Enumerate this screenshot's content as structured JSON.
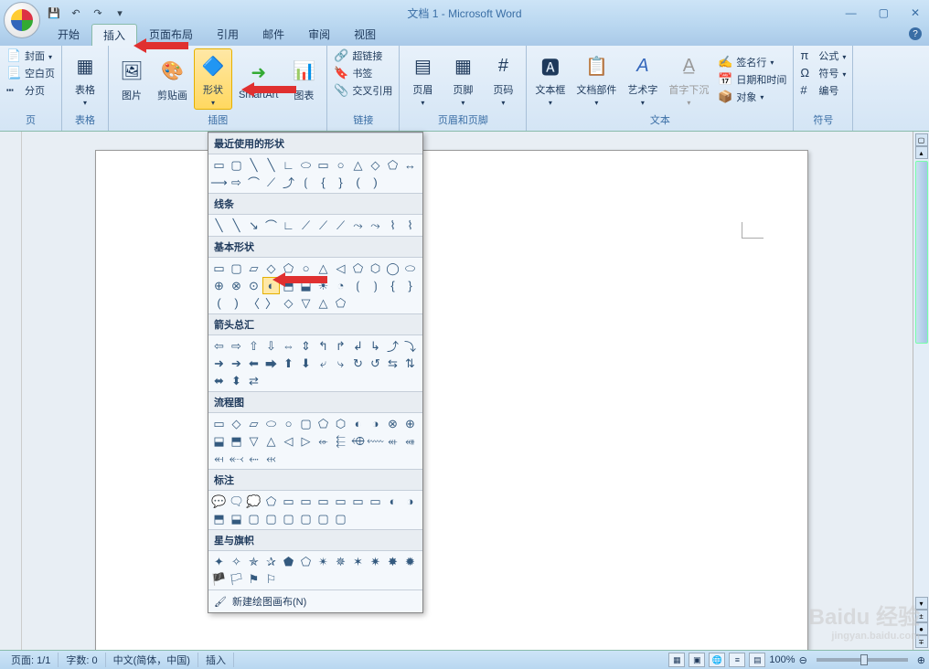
{
  "title": "文档 1 - Microsoft Word",
  "tabs": [
    "开始",
    "插入",
    "页面布局",
    "引用",
    "邮件",
    "审阅",
    "视图"
  ],
  "active_tab_index": 1,
  "ribbon": {
    "groups": {
      "pages": {
        "label": "页",
        "cover": "封面",
        "blank": "空白页",
        "break": "分页"
      },
      "tables": {
        "label": "表格",
        "table": "表格"
      },
      "illustrations": {
        "label": "插图",
        "picture": "图片",
        "clipart": "剪贴画",
        "shapes": "形状",
        "smartart": "SmartArt",
        "chart": "图表"
      },
      "links": {
        "label": "链接",
        "hyperlink": "超链接",
        "bookmark": "书签",
        "crossref": "交叉引用"
      },
      "headerfooter": {
        "label": "页眉和页脚",
        "header": "页眉",
        "footer": "页脚",
        "pagenum": "页码"
      },
      "text": {
        "label": "文本",
        "textbox": "文本框",
        "quickparts": "文档部件",
        "wordart": "艺术字",
        "dropcap": "首字下沉",
        "signature": "签名行",
        "datetime": "日期和时间",
        "object": "对象"
      },
      "symbols": {
        "label": "符号",
        "equation": "公式",
        "symbol": "符号",
        "number": "编号"
      }
    }
  },
  "shapes_dropdown": {
    "sections": {
      "recent": "最近使用的形状",
      "lines": "线条",
      "basic": "基本形状",
      "arrows": "箭头总汇",
      "flowchart": "流程图",
      "callouts": "标注",
      "stars": "星与旗帜"
    },
    "new_canvas": "新建绘图画布(N)"
  },
  "statusbar": {
    "page": "页面: 1/1",
    "words": "字数: 0",
    "language": "中文(简体，中国)",
    "mode": "插入",
    "zoom": "100%"
  },
  "watermark": {
    "brand": "Baidu 经验",
    "url": "jingyan.baidu.com"
  }
}
